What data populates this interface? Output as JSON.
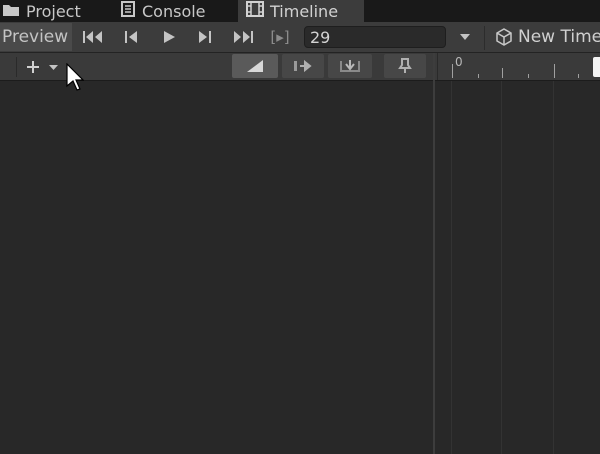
{
  "tabs": [
    {
      "label": "Project",
      "icon": "folder-icon"
    },
    {
      "label": "Console",
      "icon": "console-icon"
    },
    {
      "label": "Timeline",
      "icon": "film-icon",
      "active": true
    }
  ],
  "toolbar": {
    "preview_label": "Preview",
    "frame_value": "29",
    "new_timeline_label": "New Time",
    "range_icon_label": "[▸]"
  },
  "ruler": {
    "start_label": "0"
  },
  "colors": {
    "background": "#282828",
    "toolbar": "#3c3c3c",
    "tabbar": "#191919"
  }
}
